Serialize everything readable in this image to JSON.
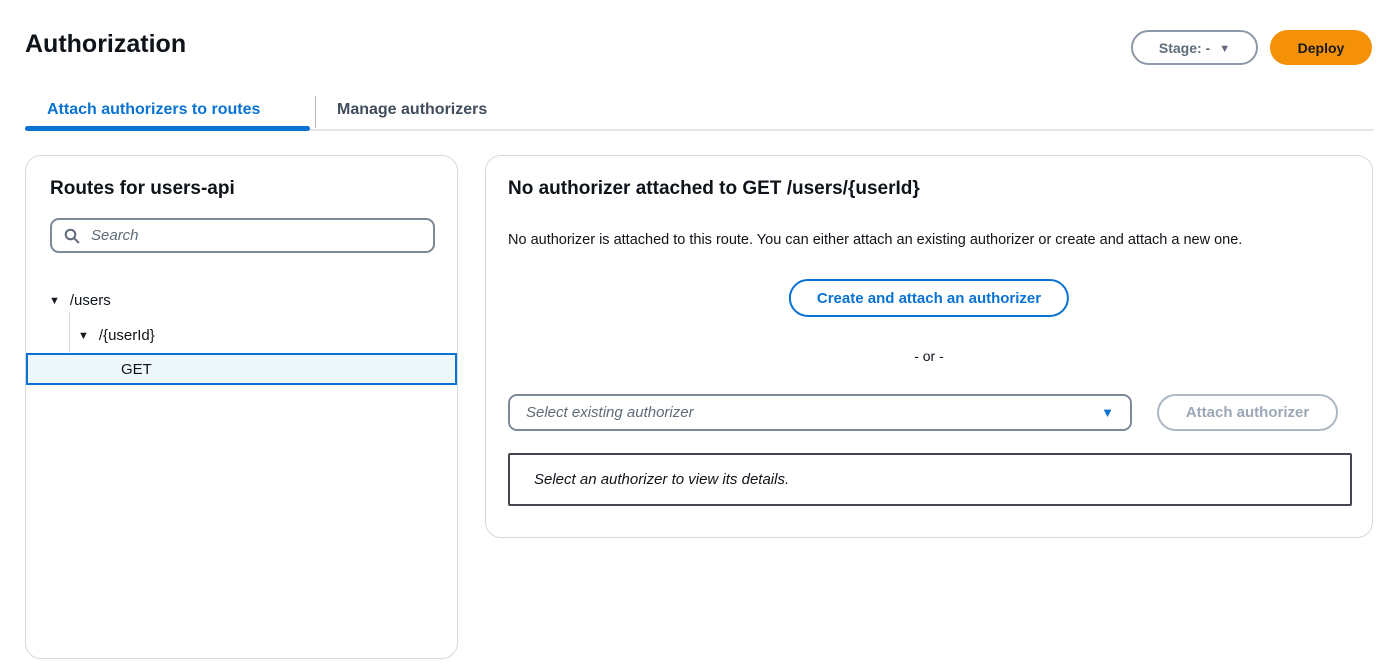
{
  "page": {
    "title": "Authorization"
  },
  "header": {
    "stage_button": {
      "label": "Stage: -"
    },
    "deploy_button": {
      "label": "Deploy"
    }
  },
  "tabs": [
    {
      "label": "Attach authorizers to routes",
      "active": true
    },
    {
      "label": "Manage authorizers",
      "active": false
    }
  ],
  "routes_panel": {
    "title": "Routes for users-api",
    "search_placeholder": "Search",
    "tree": [
      {
        "label": "/users",
        "level": 1,
        "expanded": true
      },
      {
        "label": "/{userId}",
        "level": 2,
        "expanded": true
      },
      {
        "label": "GET",
        "level": 3,
        "selected": true
      }
    ]
  },
  "authorizer_panel": {
    "title": "No authorizer attached to GET /users/{userId}",
    "description": "No authorizer is attached to this route. You can either attach an existing authorizer or create and attach a new one.",
    "create_button": "Create and attach an authorizer",
    "or_text": "- or -",
    "select_placeholder": "Select existing authorizer",
    "attach_button": "Attach authorizer",
    "details_placeholder": "Select an authorizer to view its details."
  },
  "icons": {
    "caret_down": "▼"
  },
  "colors": {
    "accent_blue": "#0972d3",
    "deploy_orange": "#f49106",
    "selected_row_bg": "#eef7fc",
    "muted_text": "#5f6b7a",
    "disabled": "#9ba7b6",
    "card_border": "#d5d9dd",
    "input_border": "#7d8998",
    "details_border": "#424650"
  }
}
